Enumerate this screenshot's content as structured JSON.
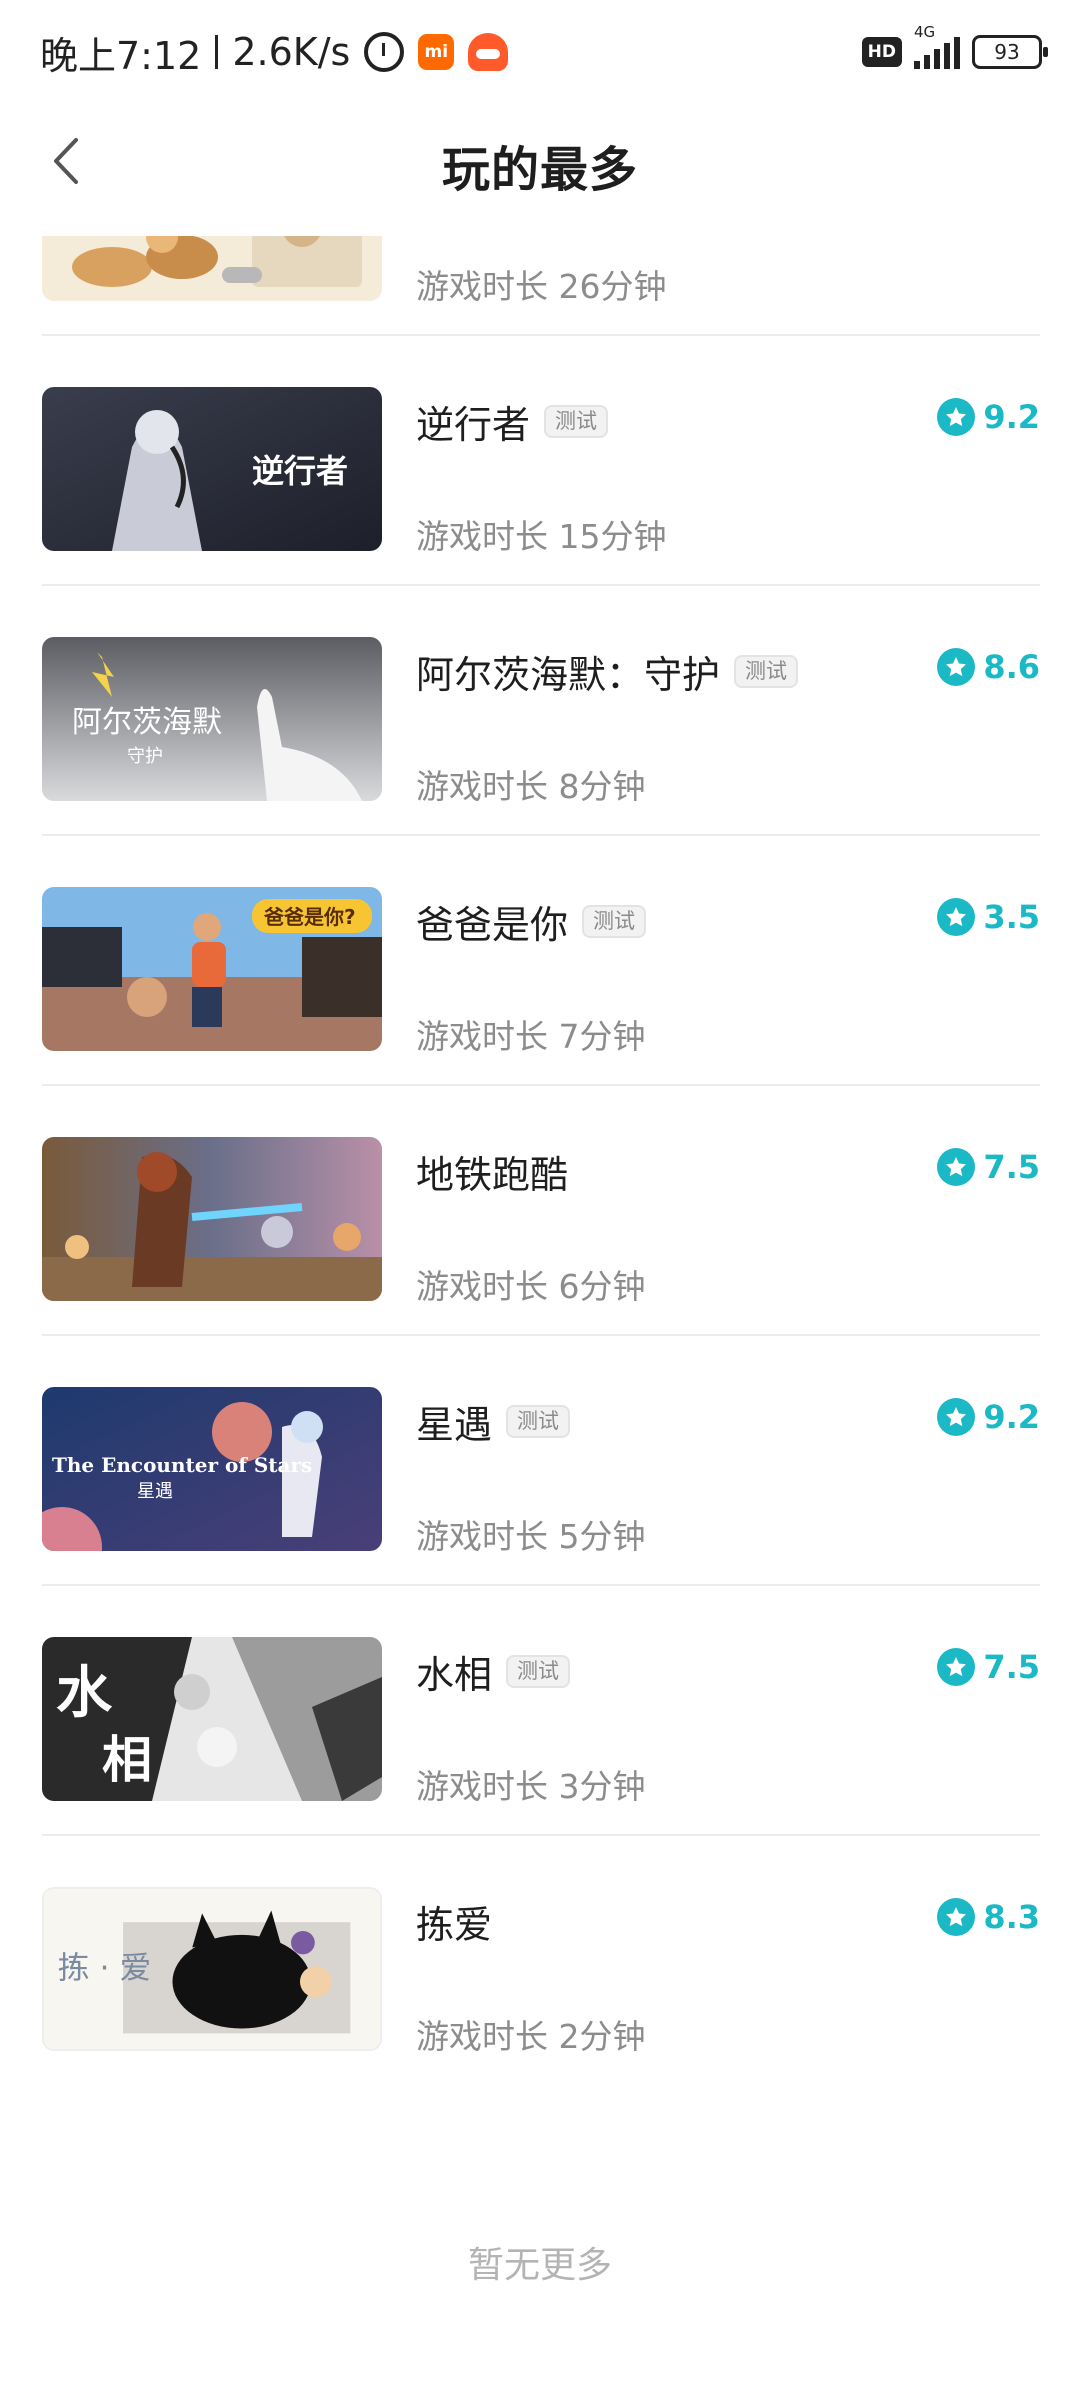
{
  "status_bar": {
    "time": "晚上7:12",
    "speed": "2.6K/s",
    "network": "4G",
    "hd_label": "HD",
    "battery": "93"
  },
  "header": {
    "title": "玩的最多"
  },
  "games": [
    {
      "name": "",
      "badge": "",
      "score": "",
      "duration": "游戏时长 26分钟"
    },
    {
      "name": "逆行者",
      "badge": "测试",
      "score": "9.2",
      "duration": "游戏时长 15分钟",
      "thumb_text": "逆行者"
    },
    {
      "name": "阿尔茨海默：守护",
      "badge": "测试",
      "score": "8.6",
      "duration": "游戏时长 8分钟",
      "thumb_text": "阿尔茨海默",
      "thumb_subtext": "守护"
    },
    {
      "name": "爸爸是你",
      "badge": "测试",
      "score": "3.5",
      "duration": "游戏时长 7分钟",
      "thumb_text": "爸爸是你?"
    },
    {
      "name": "地铁跑酷",
      "badge": "",
      "score": "7.5",
      "duration": "游戏时长 6分钟"
    },
    {
      "name": "星遇",
      "badge": "测试",
      "score": "9.2",
      "duration": "游戏时长 5分钟",
      "thumb_text": "The Encounter of Stars",
      "thumb_subtext": "星遇"
    },
    {
      "name": "水相",
      "badge": "测试",
      "score": "7.5",
      "duration": "游戏时长 3分钟",
      "thumb_text": "水",
      "thumb_subtext": "相"
    },
    {
      "name": "拣爱",
      "badge": "",
      "score": "8.3",
      "duration": "游戏时长 2分钟",
      "thumb_text": "拣 · 爱"
    }
  ],
  "footer": {
    "text": "暂无更多"
  },
  "colors": {
    "accent": "#1bb8c5",
    "muted_text": "#8c8c8c",
    "divider": "#ececec"
  }
}
